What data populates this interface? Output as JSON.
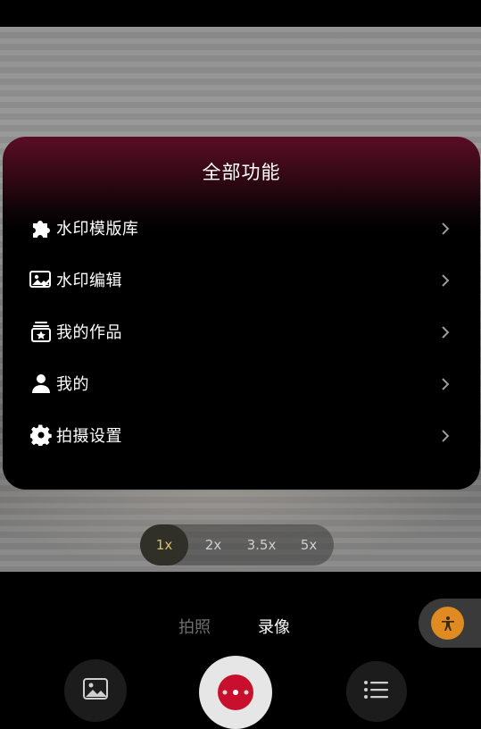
{
  "panel": {
    "title": "全部功能",
    "items": [
      {
        "label": "水印模版库",
        "icon": "puzzle-icon"
      },
      {
        "label": "水印编辑",
        "icon": "image-edit-icon"
      },
      {
        "label": "我的作品",
        "icon": "my-works-icon"
      },
      {
        "label": "我的",
        "icon": "person-icon"
      },
      {
        "label": "拍摄设置",
        "icon": "gear-icon"
      }
    ]
  },
  "zoom": {
    "options": [
      "1x",
      "2x",
      "3.5x",
      "5x"
    ],
    "selected": "1x"
  },
  "modes": {
    "photo": "拍照",
    "video": "录像",
    "selected": "录像"
  },
  "bottom": {
    "gallery_icon": "gallery-icon",
    "shutter_icon": "record-button-icon",
    "menu_icon": "list-menu-icon",
    "accessibility_icon": "accessibility-icon"
  },
  "colors": {
    "panel_top": "#5a0d26",
    "zoom_active": "#d8c36a",
    "accessibility_bg": "#e08a22",
    "record_red": "#c8102e"
  }
}
